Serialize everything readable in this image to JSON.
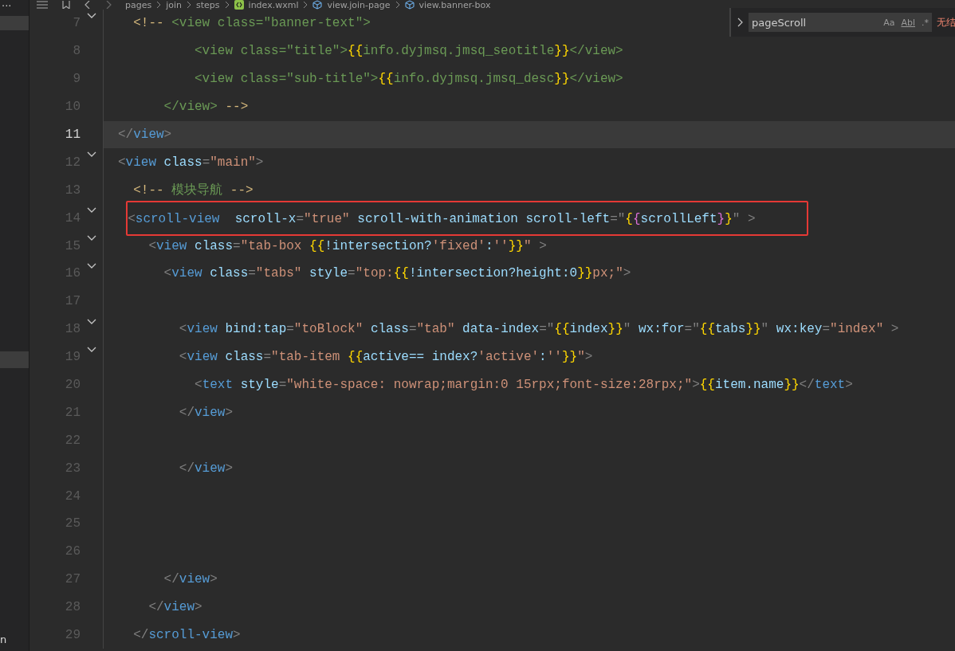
{
  "sidebar": {
    "more": "...",
    "footer_text": "n"
  },
  "breadcrumb": [
    {
      "label": "pages",
      "kind": "folder"
    },
    {
      "label": "join",
      "kind": "folder"
    },
    {
      "label": "steps",
      "kind": "folder"
    },
    {
      "label": "index.wxml",
      "kind": "file"
    },
    {
      "label": "view.join-page",
      "kind": "element"
    },
    {
      "label": "view.banner-box",
      "kind": "element"
    }
  ],
  "find_widget": {
    "value": "pageScroll",
    "options": [
      "Aa",
      "Abl",
      ".*"
    ],
    "result": "无结"
  },
  "lines": [
    {
      "number": "7",
      "fold": true,
      "current": false,
      "boxed": false,
      "tokens": [
        {
          "kind": "marker",
          "text": "  <!--"
        },
        {
          "kind": "comment",
          "text": " <view class=\"banner-text\">"
        }
      ]
    },
    {
      "number": "8",
      "fold": false,
      "current": false,
      "boxed": false,
      "tokens": [
        {
          "kind": "comment",
          "text": "          <view class=\"title\">"
        },
        {
          "kind": "brace",
          "text": "{{"
        },
        {
          "kind": "comment",
          "text": "info.dyjmsq.jmsq_seotitle"
        },
        {
          "kind": "brace",
          "text": "}}"
        },
        {
          "kind": "comment",
          "text": "</view>"
        }
      ]
    },
    {
      "number": "9",
      "fold": false,
      "current": false,
      "boxed": false,
      "tokens": [
        {
          "kind": "comment",
          "text": "          <view class=\"sub-title\">"
        },
        {
          "kind": "brace",
          "text": "{{"
        },
        {
          "kind": "comment",
          "text": "info.dyjmsq.jmsq_desc"
        },
        {
          "kind": "brace",
          "text": "}}"
        },
        {
          "kind": "comment",
          "text": "</view>"
        }
      ]
    },
    {
      "number": "10",
      "fold": false,
      "current": false,
      "boxed": false,
      "tokens": [
        {
          "kind": "comment",
          "text": "      </view> "
        },
        {
          "kind": "marker",
          "text": "-->"
        }
      ]
    },
    {
      "number": "11",
      "fold": false,
      "current": true,
      "boxed": false,
      "tokens": [
        {
          "kind": "punct",
          "text": "</"
        },
        {
          "kind": "tag",
          "text": "view"
        },
        {
          "kind": "punct",
          "text": ">"
        }
      ]
    },
    {
      "number": "12",
      "fold": true,
      "current": false,
      "boxed": false,
      "tokens": [
        {
          "kind": "punct",
          "text": "<"
        },
        {
          "kind": "tag",
          "text": "view"
        },
        {
          "kind": "attr",
          "text": " class"
        },
        {
          "kind": "punct",
          "text": "="
        },
        {
          "kind": "string",
          "text": "\"main\""
        },
        {
          "kind": "punct",
          "text": ">"
        }
      ]
    },
    {
      "number": "13",
      "fold": false,
      "current": false,
      "boxed": false,
      "tokens": [
        {
          "kind": "marker",
          "text": "  <!--"
        },
        {
          "kind": "comment",
          "text": " 模块导航 "
        },
        {
          "kind": "marker",
          "text": "-->"
        }
      ]
    },
    {
      "number": "14",
      "fold": true,
      "current": false,
      "boxed": true,
      "tokens": [
        {
          "kind": "punct",
          "text": "  <"
        },
        {
          "kind": "tag",
          "text": "scroll-view"
        },
        {
          "kind": "attr",
          "text": "  scroll-x"
        },
        {
          "kind": "punct",
          "text": "="
        },
        {
          "kind": "string",
          "text": "\"true\""
        },
        {
          "kind": "attr",
          "text": " scroll-with-animation scroll-left"
        },
        {
          "kind": "punct",
          "text": "=\""
        },
        {
          "kind": "brace",
          "text": "{"
        },
        {
          "kind": "brace2",
          "text": "{"
        },
        {
          "kind": "expr",
          "text": "scrollLeft"
        },
        {
          "kind": "brace2",
          "text": "}"
        },
        {
          "kind": "brace",
          "text": "}"
        },
        {
          "kind": "punct",
          "text": "\" >"
        }
      ]
    },
    {
      "number": "15",
      "fold": true,
      "current": false,
      "boxed": false,
      "tokens": [
        {
          "kind": "punct",
          "text": "    <"
        },
        {
          "kind": "tag",
          "text": "view"
        },
        {
          "kind": "attr",
          "text": " class"
        },
        {
          "kind": "punct",
          "text": "="
        },
        {
          "kind": "string",
          "text": "\"tab-box "
        },
        {
          "kind": "brace",
          "text": "{{"
        },
        {
          "kind": "expr",
          "text": "!intersection?"
        },
        {
          "kind": "string",
          "text": "'fixed'"
        },
        {
          "kind": "expr",
          "text": ":"
        },
        {
          "kind": "string",
          "text": "''"
        },
        {
          "kind": "brace",
          "text": "}}"
        },
        {
          "kind": "string",
          "text": "\""
        },
        {
          "kind": "punct",
          "text": " >"
        }
      ]
    },
    {
      "number": "16",
      "fold": true,
      "current": false,
      "boxed": false,
      "tokens": [
        {
          "kind": "punct",
          "text": "      <"
        },
        {
          "kind": "tag",
          "text": "view"
        },
        {
          "kind": "attr",
          "text": " class"
        },
        {
          "kind": "punct",
          "text": "="
        },
        {
          "kind": "string",
          "text": "\"tabs\""
        },
        {
          "kind": "attr",
          "text": " style"
        },
        {
          "kind": "punct",
          "text": "="
        },
        {
          "kind": "string",
          "text": "\"top:"
        },
        {
          "kind": "brace",
          "text": "{{"
        },
        {
          "kind": "expr",
          "text": "!intersection?height:0"
        },
        {
          "kind": "brace",
          "text": "}}"
        },
        {
          "kind": "string",
          "text": "px;\""
        },
        {
          "kind": "punct",
          "text": ">"
        }
      ]
    },
    {
      "number": "17",
      "fold": false,
      "current": false,
      "boxed": false
    },
    {
      "number": "18",
      "fold": true,
      "current": false,
      "boxed": false,
      "tokens": [
        {
          "kind": "punct",
          "text": "        <"
        },
        {
          "kind": "tag",
          "text": "view"
        },
        {
          "kind": "attr",
          "text": " bind:tap"
        },
        {
          "kind": "punct",
          "text": "="
        },
        {
          "kind": "string",
          "text": "\"toBlock\""
        },
        {
          "kind": "attr",
          "text": " class"
        },
        {
          "kind": "punct",
          "text": "="
        },
        {
          "kind": "string",
          "text": "\"tab\""
        },
        {
          "kind": "attr",
          "text": " data-index"
        },
        {
          "kind": "punct",
          "text": "=\""
        },
        {
          "kind": "brace",
          "text": "{{"
        },
        {
          "kind": "expr",
          "text": "index"
        },
        {
          "kind": "brace",
          "text": "}}"
        },
        {
          "kind": "punct",
          "text": "\""
        },
        {
          "kind": "attr",
          "text": " wx:for"
        },
        {
          "kind": "punct",
          "text": "=\""
        },
        {
          "kind": "brace",
          "text": "{{"
        },
        {
          "kind": "expr",
          "text": "tabs"
        },
        {
          "kind": "brace",
          "text": "}}"
        },
        {
          "kind": "punct",
          "text": "\""
        },
        {
          "kind": "attr",
          "text": " wx:key"
        },
        {
          "kind": "punct",
          "text": "="
        },
        {
          "kind": "string",
          "text": "\"index\""
        },
        {
          "kind": "punct",
          "text": " >"
        }
      ]
    },
    {
      "number": "19",
      "fold": true,
      "current": false,
      "boxed": false,
      "tokens": [
        {
          "kind": "punct",
          "text": "        <"
        },
        {
          "kind": "tag",
          "text": "view"
        },
        {
          "kind": "attr",
          "text": " class"
        },
        {
          "kind": "punct",
          "text": "="
        },
        {
          "kind": "string",
          "text": "\"tab-item "
        },
        {
          "kind": "brace",
          "text": "{{"
        },
        {
          "kind": "expr",
          "text": "active== index?"
        },
        {
          "kind": "string",
          "text": "'active'"
        },
        {
          "kind": "expr",
          "text": ":"
        },
        {
          "kind": "string",
          "text": "''"
        },
        {
          "kind": "brace",
          "text": "}}"
        },
        {
          "kind": "string",
          "text": "\""
        },
        {
          "kind": "punct",
          "text": ">"
        }
      ]
    },
    {
      "number": "20",
      "fold": false,
      "current": false,
      "boxed": false,
      "tokens": [
        {
          "kind": "punct",
          "text": "          <"
        },
        {
          "kind": "tag",
          "text": "text"
        },
        {
          "kind": "attr",
          "text": " style"
        },
        {
          "kind": "punct",
          "text": "="
        },
        {
          "kind": "string",
          "text": "\"white-space: nowrap;margin:0 15rpx;font-size:28rpx;\""
        },
        {
          "kind": "punct",
          "text": ">"
        },
        {
          "kind": "brace",
          "text": "{{"
        },
        {
          "kind": "expr",
          "text": "item.name"
        },
        {
          "kind": "brace",
          "text": "}}"
        },
        {
          "kind": "punct",
          "text": "</"
        },
        {
          "kind": "tag",
          "text": "text"
        },
        {
          "kind": "punct",
          "text": ">"
        }
      ]
    },
    {
      "number": "21",
      "fold": false,
      "current": false,
      "boxed": false,
      "tokens": [
        {
          "kind": "punct",
          "text": "        </"
        },
        {
          "kind": "tag",
          "text": "view"
        },
        {
          "kind": "punct",
          "text": ">"
        }
      ]
    },
    {
      "number": "22",
      "fold": false,
      "current": false,
      "boxed": false
    },
    {
      "number": "23",
      "fold": false,
      "current": false,
      "boxed": false,
      "tokens": [
        {
          "kind": "punct",
          "text": "        </"
        },
        {
          "kind": "tag",
          "text": "view"
        },
        {
          "kind": "punct",
          "text": ">"
        }
      ]
    },
    {
      "number": "24",
      "fold": false,
      "current": false,
      "boxed": false
    },
    {
      "number": "25",
      "fold": false,
      "current": false,
      "boxed": false
    },
    {
      "number": "26",
      "fold": false,
      "current": false,
      "boxed": false
    },
    {
      "number": "27",
      "fold": false,
      "current": false,
      "boxed": false,
      "tokens": [
        {
          "kind": "punct",
          "text": "      </"
        },
        {
          "kind": "tag",
          "text": "view"
        },
        {
          "kind": "punct",
          "text": ">"
        }
      ]
    },
    {
      "number": "28",
      "fold": false,
      "current": false,
      "boxed": false,
      "tokens": [
        {
          "kind": "punct",
          "text": "    </"
        },
        {
          "kind": "tag",
          "text": "view"
        },
        {
          "kind": "punct",
          "text": ">"
        }
      ]
    },
    {
      "number": "29",
      "fold": false,
      "current": false,
      "boxed": false,
      "tokens": [
        {
          "kind": "punct",
          "text": "  </"
        },
        {
          "kind": "tag",
          "text": "scroll-view"
        },
        {
          "kind": "punct",
          "text": ">"
        }
      ]
    }
  ]
}
